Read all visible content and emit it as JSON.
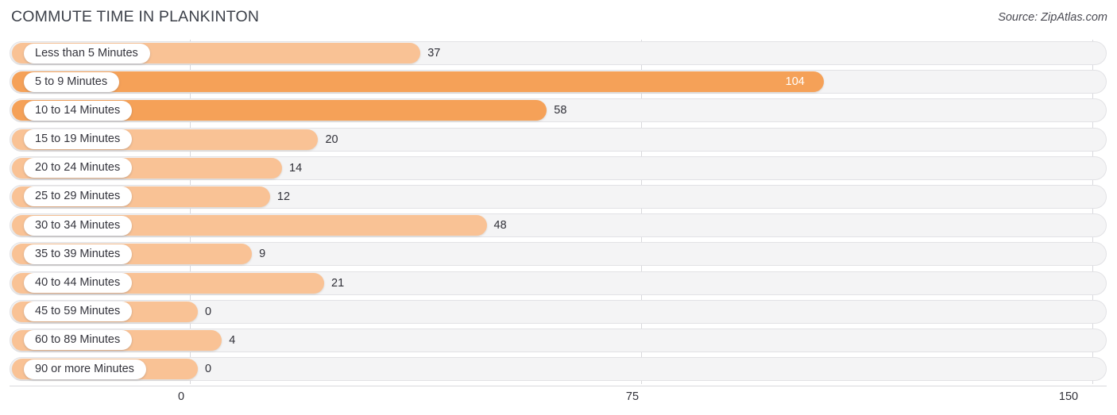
{
  "header": {
    "title": "COMMUTE TIME IN PLANKINTON",
    "source": "Source: ZipAtlas.com"
  },
  "colors": {
    "bar_light": "#f9c295",
    "bar_strong": "#f5a158",
    "track_bg": "#f4f4f5",
    "track_border": "#e2e2e5",
    "gridline": "#d8d8dc",
    "text": "#303038",
    "value_inside": "#ffffff"
  },
  "axis": {
    "ticks": [
      {
        "label": "0",
        "value": 0
      },
      {
        "label": "75",
        "value": 75
      },
      {
        "label": "150",
        "value": 150
      }
    ],
    "min": 0,
    "max": 150
  },
  "chart_data": {
    "type": "bar",
    "orientation": "horizontal",
    "title": "COMMUTE TIME IN PLANKINTON",
    "xlabel": "",
    "ylabel": "",
    "xlim": [
      0,
      150
    ],
    "grid": true,
    "legend": null,
    "source": "Source: ZipAtlas.com",
    "categories": [
      "Less than 5 Minutes",
      "5 to 9 Minutes",
      "10 to 14 Minutes",
      "15 to 19 Minutes",
      "20 to 24 Minutes",
      "25 to 29 Minutes",
      "30 to 34 Minutes",
      "35 to 39 Minutes",
      "40 to 44 Minutes",
      "45 to 59 Minutes",
      "60 to 89 Minutes",
      "90 or more Minutes"
    ],
    "values": [
      37,
      104,
      58,
      20,
      14,
      12,
      48,
      9,
      21,
      0,
      4,
      0
    ]
  },
  "rows": [
    {
      "label": "Less than 5 Minutes",
      "value": 37,
      "value_text": "37",
      "emphasis": false
    },
    {
      "label": "5 to 9 Minutes",
      "value": 104,
      "value_text": "104",
      "emphasis": true
    },
    {
      "label": "10 to 14 Minutes",
      "value": 58,
      "value_text": "58",
      "emphasis": true
    },
    {
      "label": "15 to 19 Minutes",
      "value": 20,
      "value_text": "20",
      "emphasis": false
    },
    {
      "label": "20 to 24 Minutes",
      "value": 14,
      "value_text": "14",
      "emphasis": false
    },
    {
      "label": "25 to 29 Minutes",
      "value": 12,
      "value_text": "12",
      "emphasis": false
    },
    {
      "label": "30 to 34 Minutes",
      "value": 48,
      "value_text": "48",
      "emphasis": false
    },
    {
      "label": "35 to 39 Minutes",
      "value": 9,
      "value_text": "9",
      "emphasis": false
    },
    {
      "label": "40 to 44 Minutes",
      "value": 21,
      "value_text": "21",
      "emphasis": false
    },
    {
      "label": "45 to 59 Minutes",
      "value": 0,
      "value_text": "0",
      "emphasis": false
    },
    {
      "label": "60 to 89 Minutes",
      "value": 4,
      "value_text": "4",
      "emphasis": false
    },
    {
      "label": "90 or more Minutes",
      "value": 0,
      "value_text": "0",
      "emphasis": false
    }
  ]
}
